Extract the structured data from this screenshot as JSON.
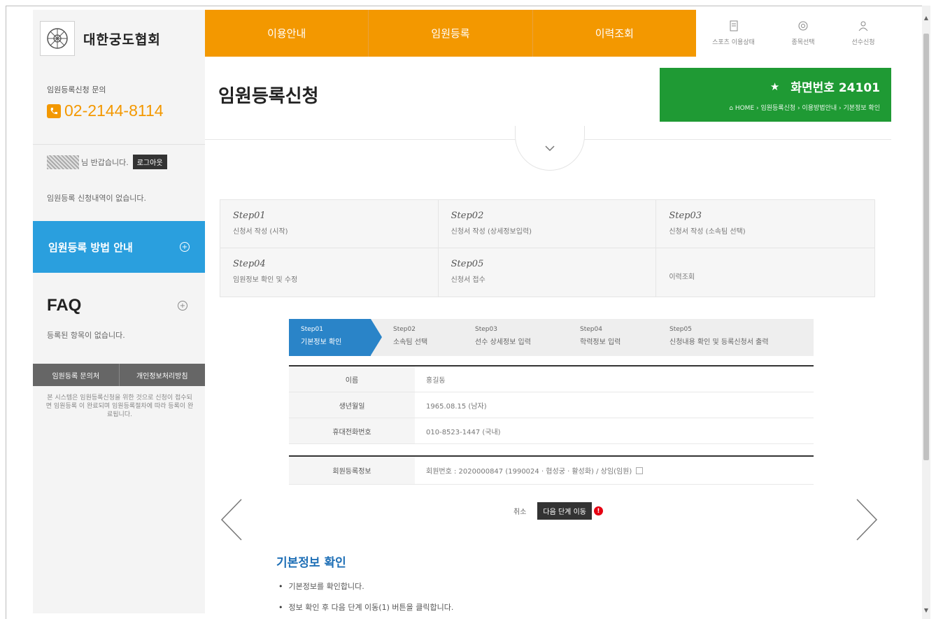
{
  "org": {
    "name": "대한궁도협회"
  },
  "sidebar": {
    "inquiry_label": "임원등록신청 문의",
    "phone": "02-2144-8114",
    "welcome": "님 반갑습니다.",
    "logout": "로그아웃",
    "no_history": "임원등록 신청내역이 없습니다.",
    "guide_button": "임원등록 방법 안내",
    "faq_title": "FAQ",
    "faq_empty": "등록된 항목이 없습니다.",
    "bottom_links": [
      "임원등록 문의처",
      "개인정보처리방침"
    ],
    "bottom_note": "본 시스템은 임원등록신청을 위한 것으로 신청이 접수되면 임원등록 이 완료되며 임원등록절차에 따라 등록이 완료됩니다."
  },
  "topnav": {
    "items": [
      "이용안내",
      "임원등록",
      "이력조회"
    ]
  },
  "util": {
    "items": [
      "스포츠 이용상태",
      "종목선택",
      "선수신청"
    ]
  },
  "page": {
    "title": "임원등록신청",
    "screen_number": "화면번호 24101",
    "breadcrumb": "HOME › 임원등록신청 › 이용방법안내 › 기본정보 확인"
  },
  "steps": [
    {
      "no": "Step01",
      "desc": "신청서 작성 (시작)"
    },
    {
      "no": "Step02",
      "desc": "신청서 작성 (상세정보입력)"
    },
    {
      "no": "Step03",
      "desc": "신청서 작성 (소속팀 선택)"
    },
    {
      "no": "Step04",
      "desc": "임원정보 확인 및 수정"
    },
    {
      "no": "Step05",
      "desc": "신청서 접수"
    },
    {
      "no": "",
      "desc": "이력조회"
    }
  ],
  "progress": [
    {
      "no": "Step01",
      "label": "기본정보 확인"
    },
    {
      "no": "Step02",
      "label": "소속팀 선택"
    },
    {
      "no": "Step03",
      "label": "선수 상세정보 입력"
    },
    {
      "no": "Step04",
      "label": "학력정보 입력"
    },
    {
      "no": "Step05",
      "label": "신청내용 확인 및 등록신청서 출력"
    }
  ],
  "info": {
    "rows": [
      {
        "label": "이름",
        "value": "홍길동"
      },
      {
        "label": "생년월일",
        "value": "1965.08.15 (남자)"
      },
      {
        "label": "휴대전화번호",
        "value": "010-8523-1447 (국내)"
      }
    ],
    "registration": {
      "label": "회원등록정보",
      "value": "회원번호 : 2020000847 (1990024 · 협성궁 · 활성화) / 상임(임원)"
    }
  },
  "actions": {
    "cancel": "취소",
    "next": "다음 단계 이동",
    "alert": "!"
  },
  "guide": {
    "title": "기본정보 확인",
    "items": [
      "기본정보를 확인합니다.",
      "정보 확인 후 다음 단계 이동(1) 버튼을 클릭합니다."
    ]
  }
}
